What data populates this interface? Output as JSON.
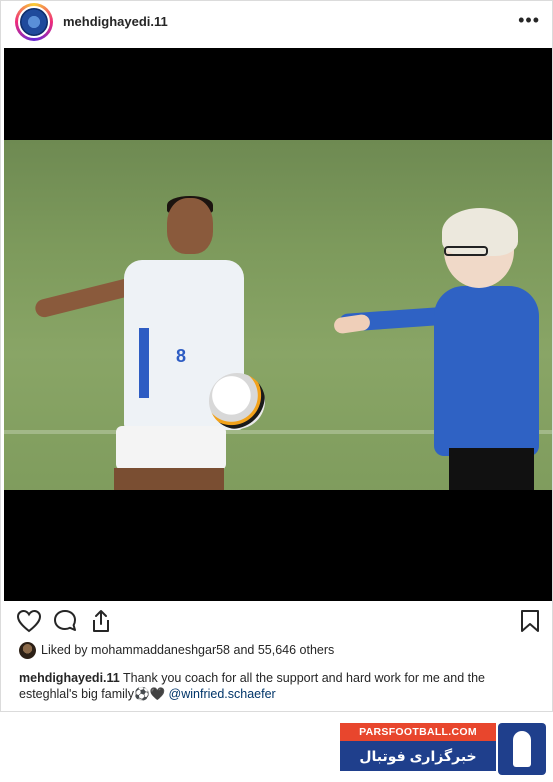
{
  "post": {
    "username": "mehdighayedi.11",
    "more_icon": "more-horizontal-icon"
  },
  "actions": {
    "like_icon": "heart-icon",
    "comment_icon": "comment-icon",
    "share_icon": "share-icon",
    "save_icon": "bookmark-icon"
  },
  "likes": {
    "prefix": "Liked by ",
    "user": "mohammaddaneshgar58",
    "suffix": " and 55,646 others"
  },
  "caption": {
    "user": "mehdighayedi.11",
    "text": " Thank you coach for all the support and hard work for me and the esteghlal's big family⚽🖤 ",
    "mention": "@winfried.schaefer"
  },
  "watermark": {
    "site": "PARSFOOTBALL.COM",
    "tagline": "خبرگزاری فوتبال ایران"
  },
  "photo": {
    "player_number": "8"
  },
  "colors": {
    "mention": "#003569",
    "watermark_red": "#e8462d",
    "watermark_blue": "#1f3f8c"
  }
}
